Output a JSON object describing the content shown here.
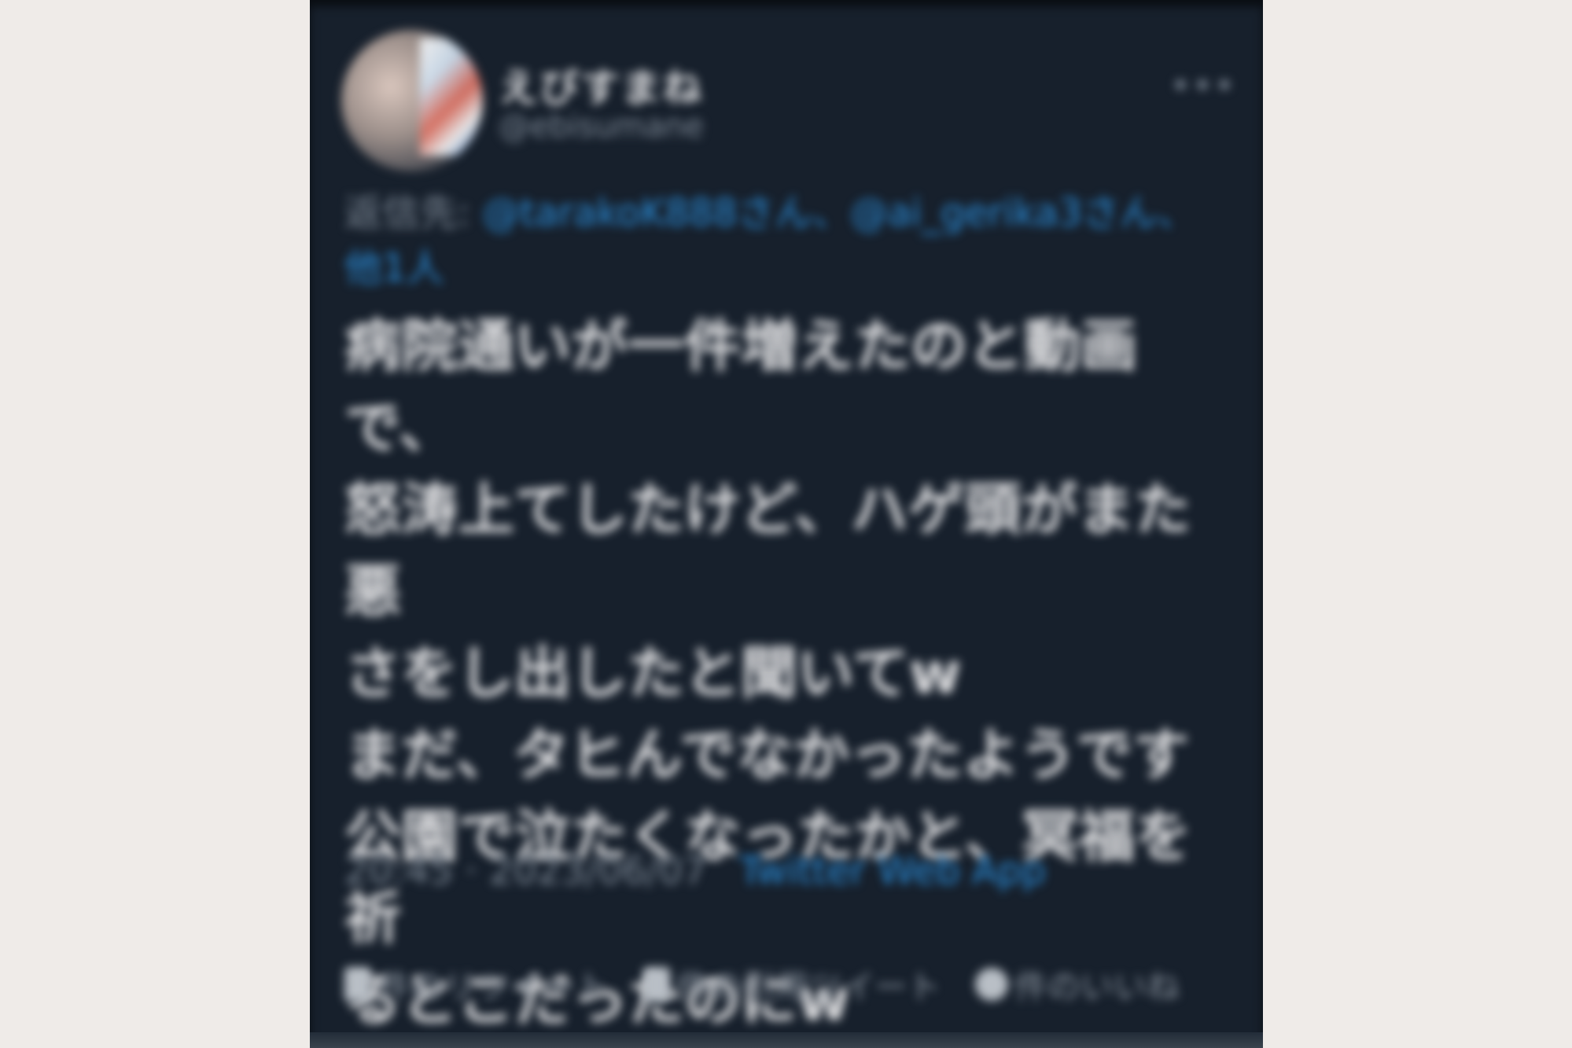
{
  "tweet": {
    "display_name": "えびすまね",
    "handle": "@ebisumane",
    "more_icon": "more-dots-icon",
    "reply_prefix": "返信先:",
    "reply_mentions": "@tarakoK888さん、@ai_gerika3さん、他1人",
    "body": "病院通いが一件増えたのと動画で、\n怒涛上てしたけど、ハゲ頭がまた悪\nさをし出したと聞いてw\nまだ、タヒんでなかったようです\n公園で泣たくなったかと、冥福を祈\nるとこだったのにw",
    "timestamp": "20:45 · 2023/06/07",
    "source_app": "Twitter Web App",
    "actions": [
      {
        "icon": "retweet-icon",
        "label": "件のリツイート"
      },
      {
        "icon": "quote-icon",
        "label": "件の引用ツイート"
      },
      {
        "icon": "like-icon",
        "label": "件のいいね"
      }
    ]
  },
  "colors": {
    "background": "#efebe8",
    "card": "#17202c",
    "link": "#2a8cd8",
    "text": "#e4e4e6",
    "muted": "#7c8794"
  }
}
